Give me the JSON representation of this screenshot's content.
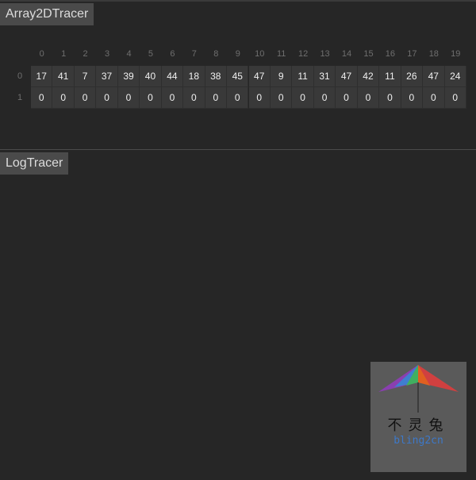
{
  "panels": {
    "array": {
      "title": "Array2DTracer"
    },
    "log": {
      "title": "LogTracer"
    }
  },
  "array2d": {
    "col_indices": [
      "0",
      "1",
      "2",
      "3",
      "4",
      "5",
      "6",
      "7",
      "8",
      "9",
      "10",
      "11",
      "12",
      "13",
      "14",
      "15",
      "16",
      "17",
      "18",
      "19"
    ],
    "row_indices": [
      "0",
      "1"
    ],
    "rows": [
      [
        "17",
        "41",
        "7",
        "37",
        "39",
        "40",
        "44",
        "18",
        "38",
        "45",
        "47",
        "9",
        "11",
        "31",
        "47",
        "42",
        "11",
        "26",
        "47",
        "24"
      ],
      [
        "0",
        "0",
        "0",
        "0",
        "0",
        "0",
        "0",
        "0",
        "0",
        "0",
        "0",
        "0",
        "0",
        "0",
        "0",
        "0",
        "0",
        "0",
        "0",
        "0"
      ]
    ]
  },
  "watermark": {
    "chars": "不灵兔",
    "text": "bling2cn"
  }
}
